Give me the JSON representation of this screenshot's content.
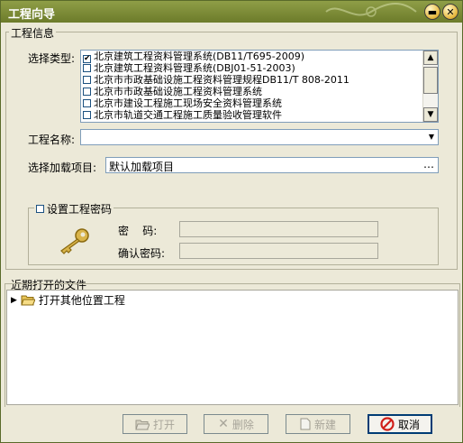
{
  "window": {
    "title": "工程向导"
  },
  "project_info": {
    "group_label": "工程信息",
    "type_label": "选择类型:",
    "types": [
      {
        "label": "北京建筑工程资料管理系统(DB11/T695-2009)",
        "checked": true
      },
      {
        "label": "北京建筑工程资料管理系统(DBJ01-51-2003)",
        "checked": false
      },
      {
        "label": "北京市市政基础设施工程资料管理规程DB11/T 808-2011",
        "checked": false
      },
      {
        "label": "北京市市政基础设施工程资料管理系统",
        "checked": false
      },
      {
        "label": "北京市建设工程施工现场安全资料管理系统",
        "checked": false
      },
      {
        "label": "北京市轨道交通工程施工质量验收管理软件",
        "checked": false
      }
    ],
    "name_label": "工程名称:",
    "name_value": "",
    "load_label": "选择加载项目:",
    "load_value": "默认加载项目",
    "browse_label": "…"
  },
  "password": {
    "checkbox_label": "设置工程密码",
    "password_label": "密    码:",
    "confirm_label": "确认密码:"
  },
  "recent": {
    "group_label": "近期打开的文件",
    "items": [
      {
        "label": "打开其他位置工程"
      }
    ]
  },
  "buttons": {
    "open": "打开",
    "delete": "删除",
    "new": "新建",
    "cancel": "取消"
  }
}
